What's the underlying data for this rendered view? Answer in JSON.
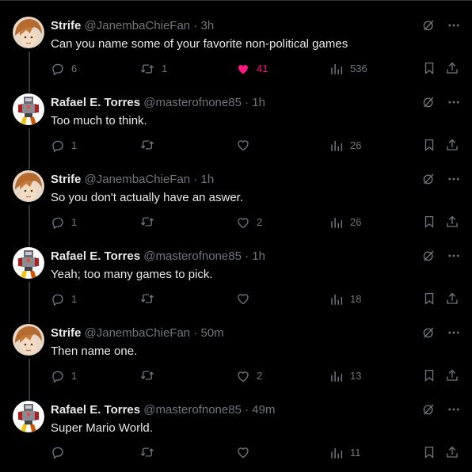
{
  "colors": {
    "background": "#000000",
    "text": "#e7e9ea",
    "muted": "#71767b",
    "like_active": "#f91880",
    "divider": "#2f3336"
  },
  "icons": {
    "reply": "reply-icon",
    "retweet": "retweet-icon",
    "like": "heart-icon",
    "views": "views-chart-icon",
    "bookmark": "bookmark-icon",
    "share": "share-icon",
    "grok": "grok-icon",
    "more": "more-icon"
  },
  "tweets": [
    {
      "name": "Strife",
      "handle": "@JanembaChieFan",
      "dot": "·",
      "time": "3h",
      "text": "Can you name some of your favorite non-political games",
      "replies": "6",
      "retweets": "1",
      "likes": "41",
      "views": "536",
      "liked": true
    },
    {
      "name": "Rafael E. Torres",
      "handle": "@masterofnone85",
      "dot": "·",
      "time": "1h",
      "text": "Too much to think.",
      "replies": "1",
      "retweets": "",
      "likes": "",
      "views": "26",
      "liked": false
    },
    {
      "name": "Strife",
      "handle": "@JanembaChieFan",
      "dot": "·",
      "time": "1h",
      "text": "So you don't actually have an aswer.",
      "replies": "1",
      "retweets": "",
      "likes": "2",
      "views": "26",
      "liked": false
    },
    {
      "name": "Rafael E. Torres",
      "handle": "@masterofnone85",
      "dot": "·",
      "time": "1h",
      "text": "Yeah; too many games to pick.",
      "replies": "1",
      "retweets": "",
      "likes": "",
      "views": "18",
      "liked": false
    },
    {
      "name": "Strife",
      "handle": "@JanembaChieFan",
      "dot": "·",
      "time": "50m",
      "text": "Then name one.",
      "replies": "1",
      "retweets": "",
      "likes": "2",
      "views": "13",
      "liked": false
    },
    {
      "name": "Rafael E. Torres",
      "handle": "@masterofnone85",
      "dot": "·",
      "time": "49m",
      "text": "Super Mario World.",
      "replies": "",
      "retweets": "",
      "likes": "",
      "views": "11",
      "liked": false
    }
  ]
}
